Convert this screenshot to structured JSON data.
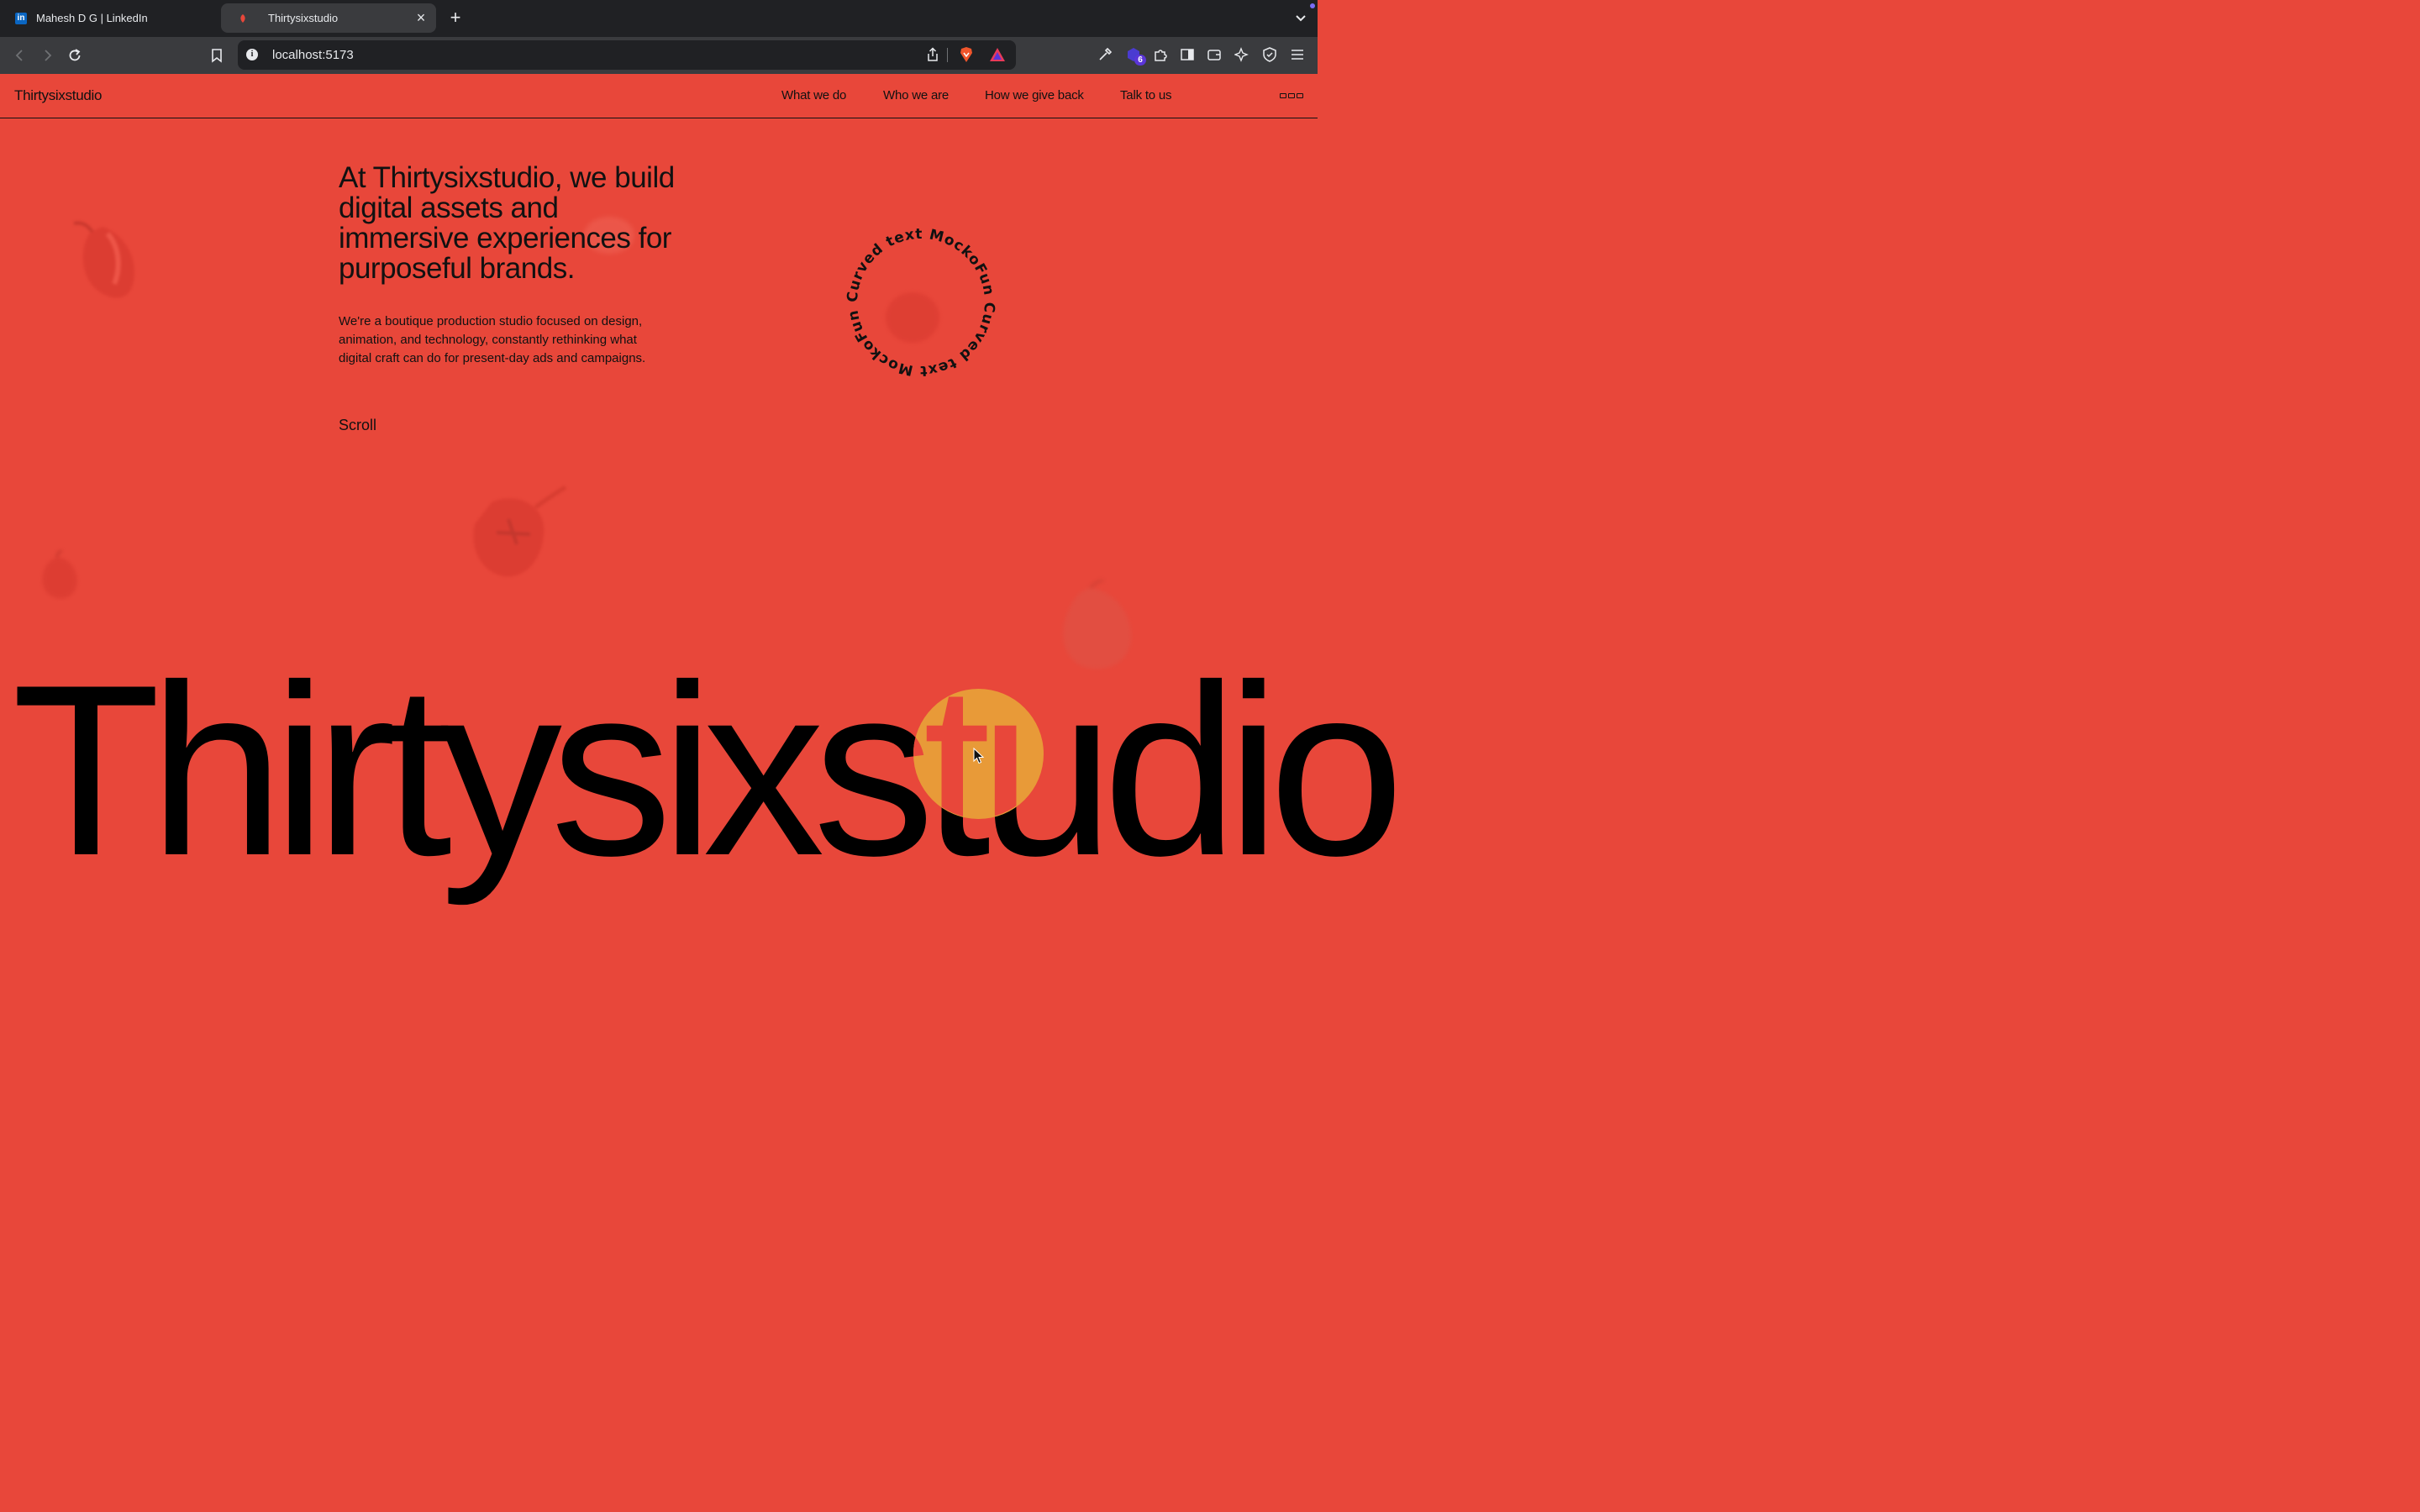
{
  "browser": {
    "tabs": [
      {
        "title": "Mahesh D G | LinkedIn",
        "active": false,
        "icon": "linkedin-icon"
      },
      {
        "title": "Thirtysixstudio",
        "active": true,
        "icon": "site-favicon"
      }
    ],
    "url": "localhost:5173",
    "extension_badge": "6"
  },
  "site": {
    "logo": "Thirtysixstudio",
    "nav": [
      "What we do",
      "Who we are",
      "How we give back",
      "Talk to us"
    ],
    "headline": "At Thirtysixstudio, we build digital assets and immersive experiences for purposeful brands.",
    "intro": "We're a boutique production studio focused on design, animation, and technology, constantly rethinking what digital craft can do for present-day ads and campaigns.",
    "scroll_label": "Scroll",
    "circular_text": "Curved text MockoFun Curved text MockoFun",
    "big_word": "Thirtysixstudio"
  },
  "colors": {
    "background": "#e8473a",
    "text": "#111111",
    "cursor_blob": "#e89a38"
  }
}
